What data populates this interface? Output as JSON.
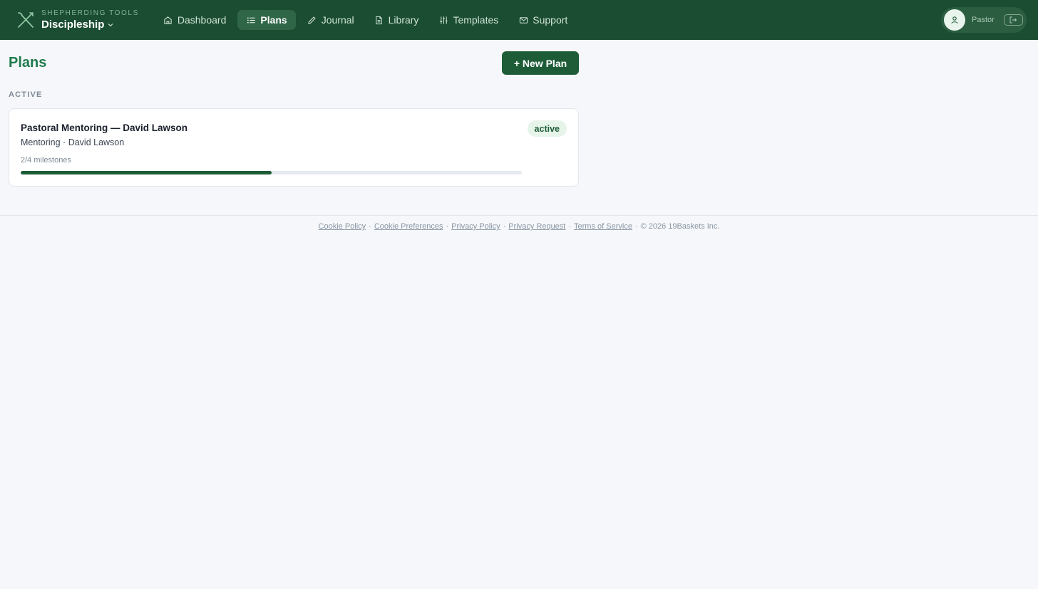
{
  "brand": {
    "eyebrow": "SHEPHERDING TOOLS",
    "name": "Discipleship"
  },
  "nav": {
    "items": [
      {
        "label": "Dashboard",
        "icon": "home-icon",
        "active": false
      },
      {
        "label": "Plans",
        "icon": "list-icon",
        "active": true
      },
      {
        "label": "Journal",
        "icon": "pencil-icon",
        "active": false
      },
      {
        "label": "Library",
        "icon": "document-icon",
        "active": false
      },
      {
        "label": "Templates",
        "icon": "sliders-icon",
        "active": false
      },
      {
        "label": "Support",
        "icon": "mail-icon",
        "active": false
      }
    ]
  },
  "user": {
    "name": "Pastor",
    "avatar_icon": "user-icon",
    "logout_icon": "logout-icon"
  },
  "page": {
    "title": "Plans",
    "new_plan_label": "+ New Plan"
  },
  "sections": {
    "active_label": "ACTIVE"
  },
  "plans": [
    {
      "title": "Pastoral Mentoring — David Lawson",
      "subtitle": "Mentoring · David Lawson",
      "status": "active",
      "milestones_text": "2/4 milestones",
      "progress": 0.5
    }
  ],
  "footer": {
    "links": [
      "Cookie Policy",
      "Cookie Preferences",
      "Privacy Policy",
      "Privacy Request",
      "Terms of Service"
    ],
    "separator": "·",
    "copyright": "© 2026 19Baskets Inc."
  },
  "colors": {
    "topbar": "#1b4d32",
    "accent": "#1e5c38",
    "title": "#1f7a4d"
  }
}
